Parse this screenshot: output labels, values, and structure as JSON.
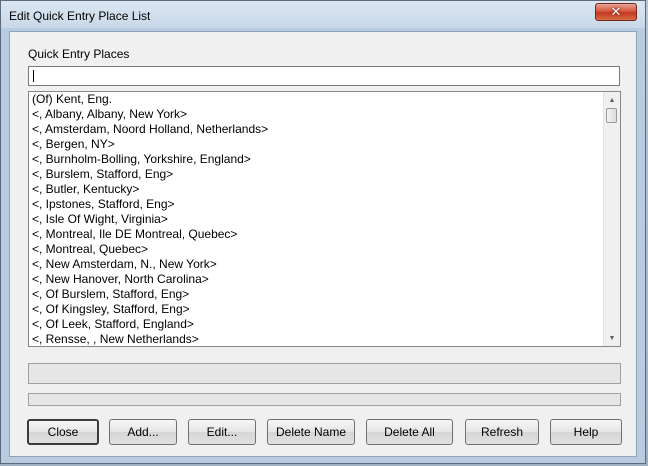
{
  "window": {
    "title": "Edit Quick Entry Place List",
    "close_glyph": "✕"
  },
  "main": {
    "section_label": "Quick Entry Places",
    "entry": {
      "value": "",
      "placeholder": ""
    },
    "places": [
      "(Of) Kent, Eng.",
      "<, Albany, Albany, New York>",
      "<, Amsterdam, Noord Holland, Netherlands>",
      "<, Bergen, NY>",
      "<, Burnholm-Bolling, Yorkshire, England>",
      "<, Burslem, Stafford, Eng>",
      "<, Butler, Kentucky>",
      "<, Ipstones, Stafford, Eng>",
      "<, Isle Of Wight, Virginia>",
      "<, Montreal, Ile DE Montreal, Quebec>",
      "<, Montreal, Quebec>",
      "<, New Amsterdam, N., New York>",
      "<, New Hanover, North Carolina>",
      "<, Of Burslem, Stafford, Eng>",
      "<, Of Kingsley, Stafford, Eng>",
      "<, Of Leek, Stafford, England>",
      "<, Rensse, , New Netherlands>"
    ],
    "scrollbar": {
      "up_icon": "triangle-up-icon",
      "down_icon": "triangle-down-icon",
      "position": 0.0
    }
  },
  "buttons": {
    "close": "Close",
    "add": "Add...",
    "edit": "Edit...",
    "delete_name": "Delete Name",
    "delete_all": "Delete All",
    "refresh": "Refresh",
    "help": "Help"
  },
  "colors": {
    "title_close_button": "#d6573d",
    "dialog_face": "#f0f0f0",
    "frame": "#b8cbe0"
  }
}
